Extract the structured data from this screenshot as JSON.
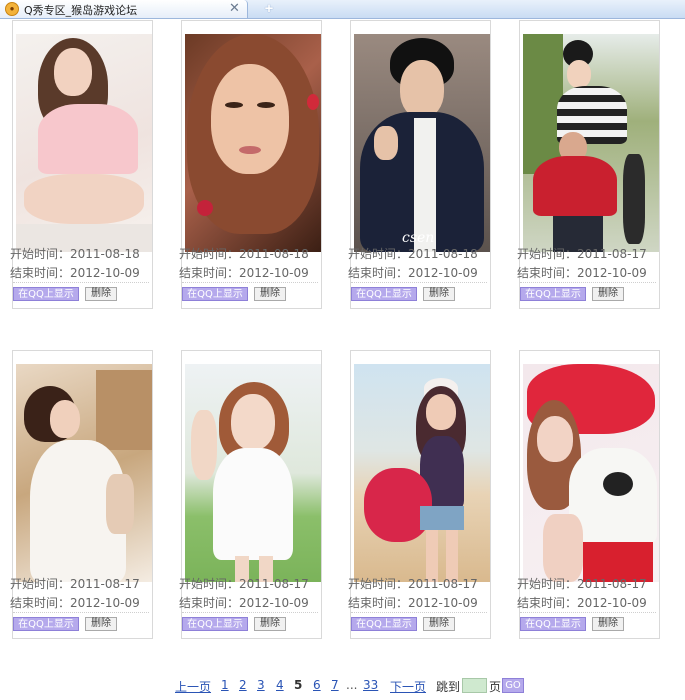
{
  "browser": {
    "tab_title": "Q秀专区_猴岛游戏论坛",
    "close_glyph": "✕",
    "new_tab_glyph": "+"
  },
  "labels": {
    "start": "开始时间：",
    "end": "结束时间：",
    "show_button": "在QQ上显示",
    "delete_button": "删除"
  },
  "cards": [
    {
      "start": "2011-08-18",
      "end": "2012-10-09",
      "photo": "girl-sitting-pink"
    },
    {
      "start": "2011-08-18",
      "end": "2012-10-09",
      "photo": "girl-closeup-redhair"
    },
    {
      "start": "2011-08-18",
      "end": "2012-10-09",
      "photo": "man-suit-scarf",
      "watermark": "csen"
    },
    {
      "start": "2011-08-17",
      "end": "2012-10-09",
      "photo": "couple-piggyback"
    },
    {
      "start": "2011-08-17",
      "end": "2012-10-09",
      "photo": "girl-back-white"
    },
    {
      "start": "2011-08-17",
      "end": "2012-10-09",
      "photo": "girl-white-dress-field"
    },
    {
      "start": "2011-08-17",
      "end": "2012-10-09",
      "photo": "girl-beach-cap"
    },
    {
      "start": "2011-08-17",
      "end": "2012-10-09",
      "photo": "girl-red-pillow"
    }
  ],
  "pager": {
    "prev": "上一页",
    "pages": [
      "1",
      "2",
      "3",
      "4",
      "5",
      "6",
      "7"
    ],
    "current": "5",
    "ellipsis": "...",
    "last": "33",
    "next": "下一页",
    "jump_label": "跳到",
    "page_unit": "页",
    "go": "GO",
    "jump_value": ""
  },
  "colors": {
    "button_purple": "#b5a9ec",
    "link_blue": "#2a54b5"
  }
}
